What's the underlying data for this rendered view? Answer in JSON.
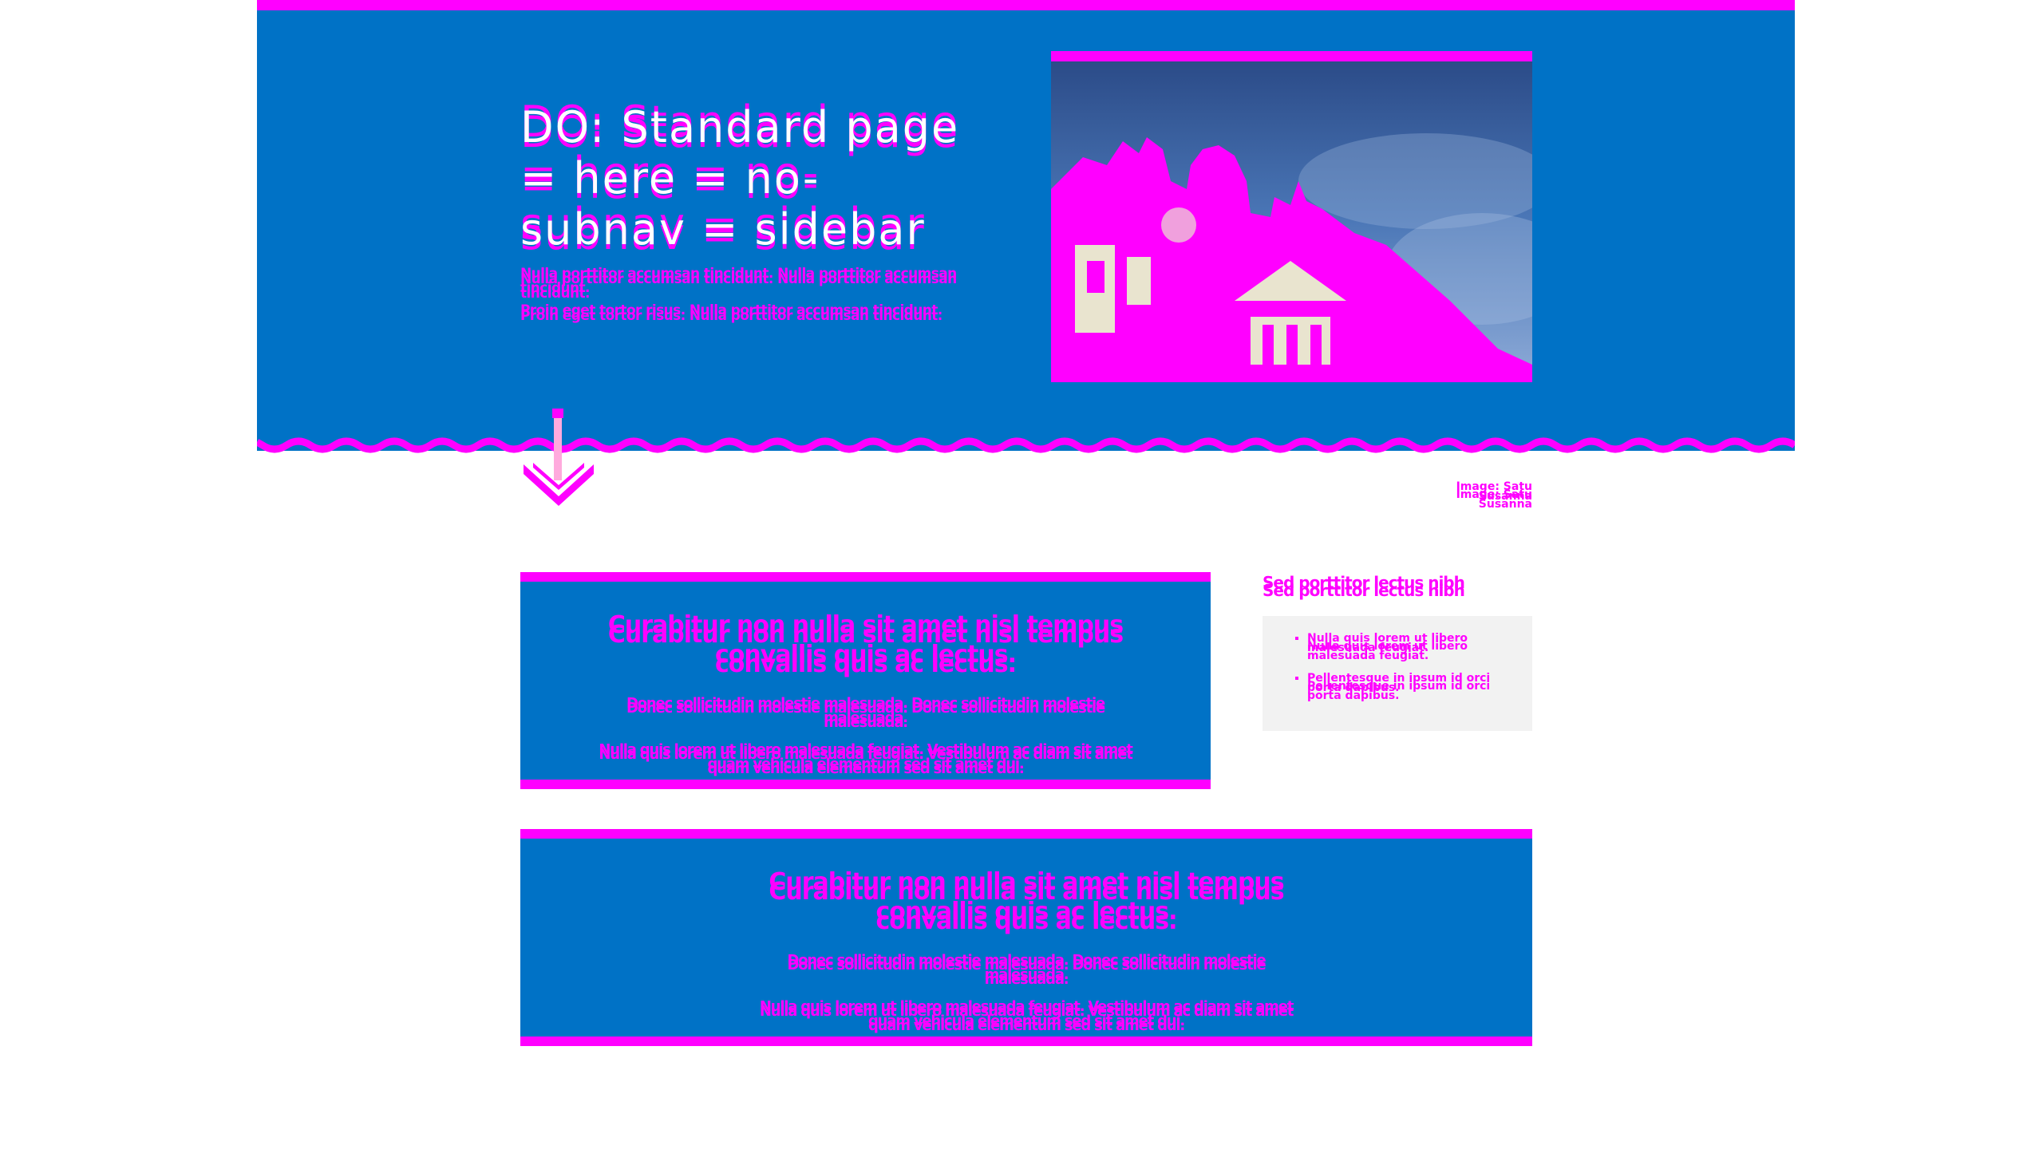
{
  "hero": {
    "title": "DO: Standard page = here = no-subnav = sidebar",
    "paragraphs": [
      "Nulla porttitor accumsan tincidunt. Nulla porttitor accumsan tincidunt.",
      "Proin eget tortor risus. Nulla porttitor accumsan tincidunt."
    ],
    "image_credit": "Image: Satu Susanna"
  },
  "cards": [
    {
      "heading": "Curabitur non nulla sit amet nisl tempus convallis quis ac lectus.",
      "paragraphs": [
        "Donec sollicitudin molestie malesuada. Donec sollicitudin molestie malesuada.",
        "Nulla quis lorem ut libero malesuada feugiat. Vestibulum ac diam sit amet quam vehicula elementum sed sit amet dui."
      ]
    },
    {
      "heading": "Curabitur non nulla sit amet nisl tempus convallis quis ac lectus.",
      "paragraphs": [
        "Donec sollicitudin molestie malesuada. Donec sollicitudin molestie malesuada.",
        "Nulla quis lorem ut libero malesuada feugiat. Vestibulum ac diam sit amet quam vehicula elementum sed sit amet dui."
      ]
    }
  ],
  "sidebar": {
    "title": "Sed porttitor lectus nibh",
    "items": [
      "Nulla quis lorem ut libero malesuada feugiat.",
      "Pellentesque in ipsum id orci porta dapibus."
    ]
  },
  "colors": {
    "hero_blue": "#0072c6",
    "accent_magenta": "#ff00ff",
    "sidebar_bg": "#f2f2f2"
  },
  "icons": {
    "scroll_down": "arrow-down-icon",
    "hero_image": "building-photo"
  }
}
